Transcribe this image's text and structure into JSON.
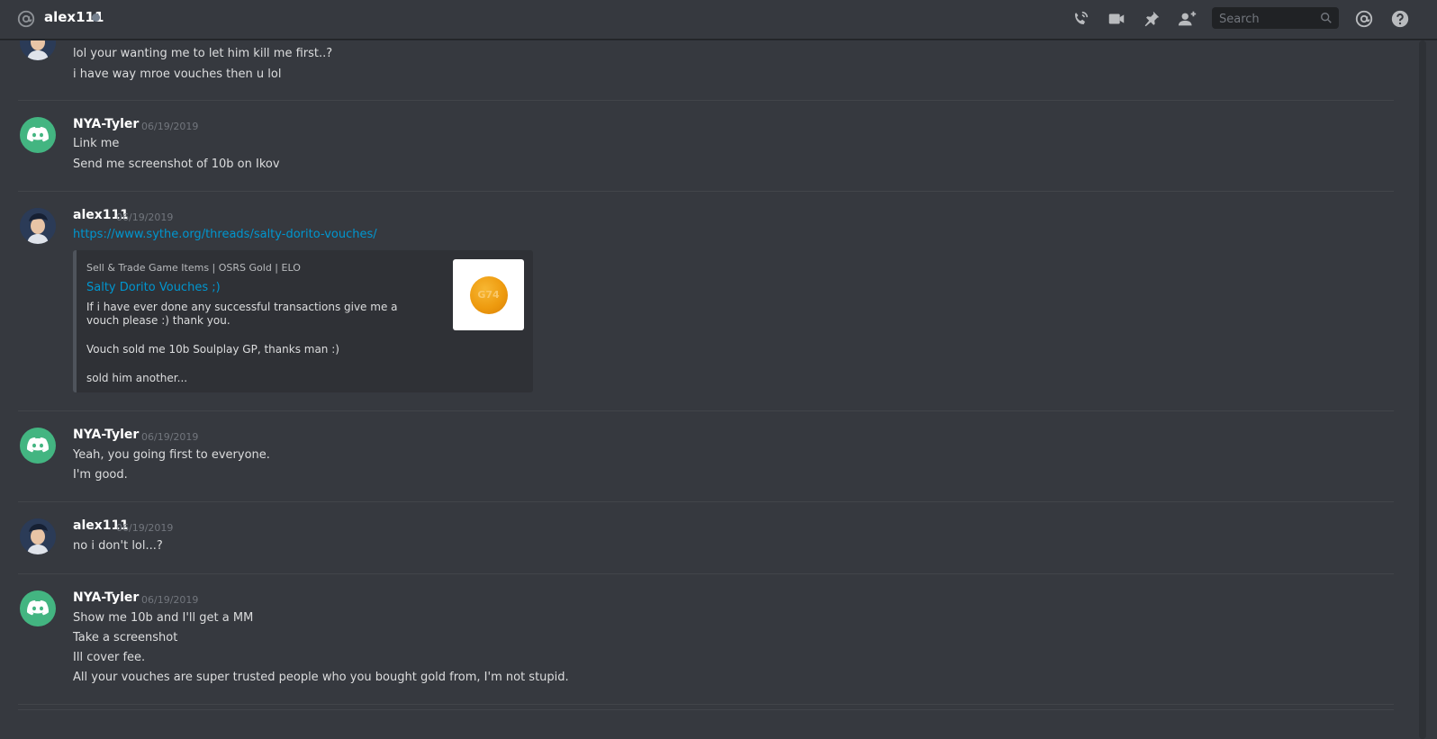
{
  "header": {
    "channel_name": "alex111",
    "search_placeholder": "Search",
    "icons": [
      "at-icon",
      "call-icon",
      "video-icon",
      "pin-icon",
      "add-user-icon",
      "search-icon",
      "mention-icon",
      "help-icon"
    ]
  },
  "colors": {
    "background": "#36393f",
    "header_border": "#202225",
    "discord_green": "#43b581",
    "link": "#0096cf",
    "timestamp": "#72767d",
    "embed_bg": "#2f3136"
  },
  "messages": [
    {
      "lines": [
        "lol your wanting me to let him kill me first..?",
        "i have way mroe vouches then u lol"
      ]
    },
    {
      "author": "NYA-Tyler",
      "timestamp": "06/19/2019",
      "lines": [
        "Link me",
        "Send me screenshot of 10b on Ikov"
      ]
    },
    {
      "author": "alex111",
      "timestamp": "06/19/2019",
      "link": "https://www.sythe.org/threads/salty-dorito-vouches/",
      "embed": {
        "provider": "Sell & Trade Game Items | OSRS Gold | ELO",
        "title": "Salty Dorito Vouches ;)",
        "desc1": "If i have ever done any successful transactions give me a vouch please :) thank you.",
        "desc2": "Vouch sold me 10b Soulplay GP, thanks man :)",
        "desc3": "sold him another...",
        "thumb_text": "G74"
      }
    },
    {
      "author": "NYA-Tyler",
      "timestamp": "06/19/2019",
      "lines": [
        "Yeah, you going first to everyone.",
        "I'm good."
      ]
    },
    {
      "author": "alex111",
      "timestamp": "06/19/2019",
      "lines": [
        "no i don't lol...?"
      ]
    },
    {
      "author": "NYA-Tyler",
      "timestamp": "06/19/2019",
      "lines": [
        "Show me 10b and I'll get a MM",
        "Take a screenshot",
        "Ill cover fee.",
        "All your vouches are super trusted people who you bought gold from, I'm not stupid."
      ]
    }
  ]
}
